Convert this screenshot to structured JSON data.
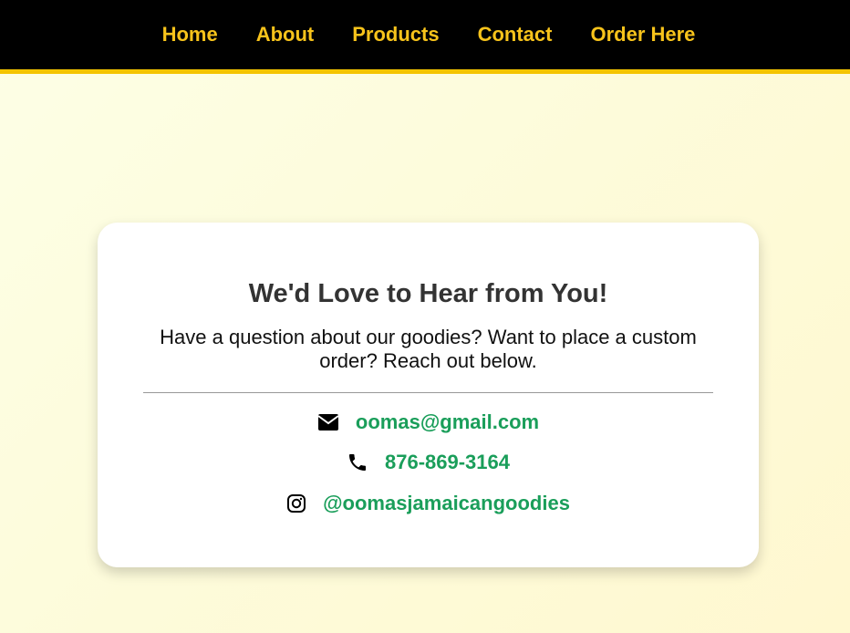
{
  "nav": {
    "items": [
      {
        "label": "Home"
      },
      {
        "label": "About"
      },
      {
        "label": "Products"
      },
      {
        "label": "Contact"
      },
      {
        "label": "Order Here"
      }
    ]
  },
  "contact": {
    "heading": "We'd Love to Hear from You!",
    "intro": "Have a question about our goodies? Want to place a custom order? Reach out below.",
    "email": "oomas@gmail.com",
    "phone": "876-869-3164",
    "instagram": "@oomasjamaicangoodies",
    "link_color": "#1a9e5a"
  },
  "colors": {
    "header_bg": "#000000",
    "nav_text": "#f7c31b",
    "header_border": "#f4c400"
  }
}
